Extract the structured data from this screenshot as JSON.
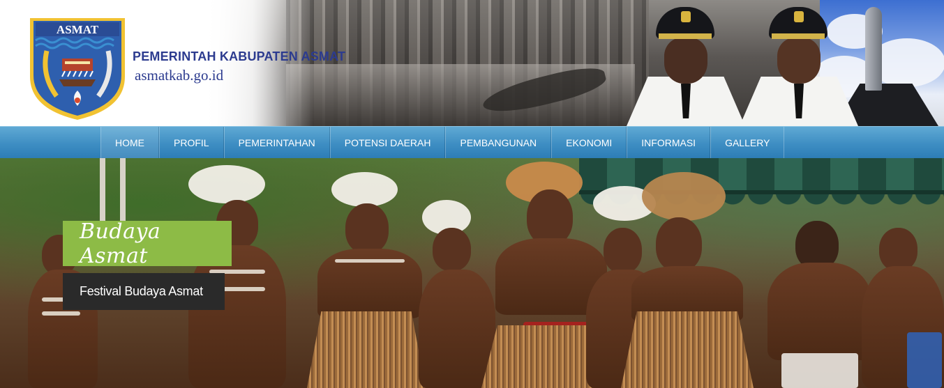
{
  "header": {
    "logo": {
      "label": "ASMAT",
      "icon": "asmat-regency-coat-of-arms",
      "colors": {
        "shield_blue": "#2e5fae",
        "shield_border": "#f1c232",
        "wave_blue": "#3a8fd1"
      }
    },
    "title": "PEMERINTAH KABUPATEN ASMAT",
    "domain": "asmatkab.go.id",
    "title_color": "#2c3b8f"
  },
  "nav": {
    "items": [
      {
        "label": "HOME"
      },
      {
        "label": "PROFIL"
      },
      {
        "label": "PEMERINTAHAN"
      },
      {
        "label": "POTENSI DAERAH"
      },
      {
        "label": "PEMBANGUNAN"
      },
      {
        "label": "EKONOMI"
      },
      {
        "label": "INFORMASI"
      },
      {
        "label": "GALLERY"
      }
    ],
    "background": "#3e8ec3"
  },
  "slider": {
    "title": "Budaya Asmat",
    "caption": "Festival Budaya Asmat",
    "title_bg": "#8dbb46",
    "caption_bg": "#2a2a2a"
  }
}
